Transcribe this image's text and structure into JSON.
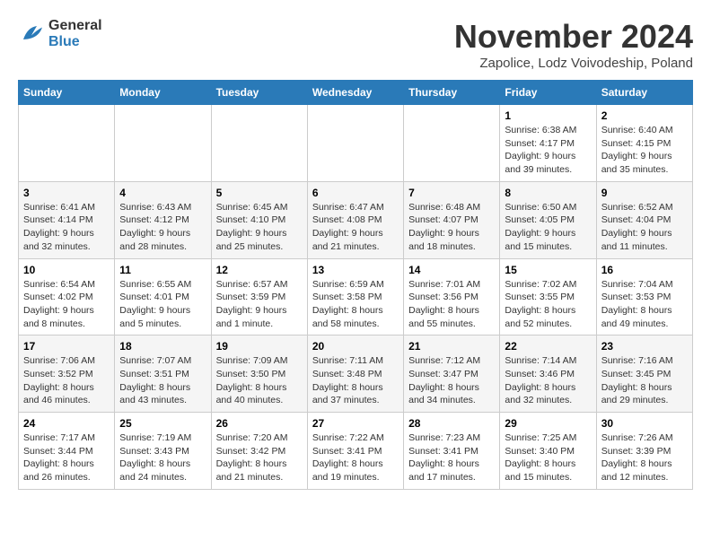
{
  "header": {
    "logo_line1": "General",
    "logo_line2": "Blue",
    "month": "November 2024",
    "location": "Zapolice, Lodz Voivodeship, Poland"
  },
  "days_of_week": [
    "Sunday",
    "Monday",
    "Tuesday",
    "Wednesday",
    "Thursday",
    "Friday",
    "Saturday"
  ],
  "weeks": [
    [
      {
        "day": "",
        "info": ""
      },
      {
        "day": "",
        "info": ""
      },
      {
        "day": "",
        "info": ""
      },
      {
        "day": "",
        "info": ""
      },
      {
        "day": "",
        "info": ""
      },
      {
        "day": "1",
        "info": "Sunrise: 6:38 AM\nSunset: 4:17 PM\nDaylight: 9 hours\nand 39 minutes."
      },
      {
        "day": "2",
        "info": "Sunrise: 6:40 AM\nSunset: 4:15 PM\nDaylight: 9 hours\nand 35 minutes."
      }
    ],
    [
      {
        "day": "3",
        "info": "Sunrise: 6:41 AM\nSunset: 4:14 PM\nDaylight: 9 hours\nand 32 minutes."
      },
      {
        "day": "4",
        "info": "Sunrise: 6:43 AM\nSunset: 4:12 PM\nDaylight: 9 hours\nand 28 minutes."
      },
      {
        "day": "5",
        "info": "Sunrise: 6:45 AM\nSunset: 4:10 PM\nDaylight: 9 hours\nand 25 minutes."
      },
      {
        "day": "6",
        "info": "Sunrise: 6:47 AM\nSunset: 4:08 PM\nDaylight: 9 hours\nand 21 minutes."
      },
      {
        "day": "7",
        "info": "Sunrise: 6:48 AM\nSunset: 4:07 PM\nDaylight: 9 hours\nand 18 minutes."
      },
      {
        "day": "8",
        "info": "Sunrise: 6:50 AM\nSunset: 4:05 PM\nDaylight: 9 hours\nand 15 minutes."
      },
      {
        "day": "9",
        "info": "Sunrise: 6:52 AM\nSunset: 4:04 PM\nDaylight: 9 hours\nand 11 minutes."
      }
    ],
    [
      {
        "day": "10",
        "info": "Sunrise: 6:54 AM\nSunset: 4:02 PM\nDaylight: 9 hours\nand 8 minutes."
      },
      {
        "day": "11",
        "info": "Sunrise: 6:55 AM\nSunset: 4:01 PM\nDaylight: 9 hours\nand 5 minutes."
      },
      {
        "day": "12",
        "info": "Sunrise: 6:57 AM\nSunset: 3:59 PM\nDaylight: 9 hours\nand 1 minute."
      },
      {
        "day": "13",
        "info": "Sunrise: 6:59 AM\nSunset: 3:58 PM\nDaylight: 8 hours\nand 58 minutes."
      },
      {
        "day": "14",
        "info": "Sunrise: 7:01 AM\nSunset: 3:56 PM\nDaylight: 8 hours\nand 55 minutes."
      },
      {
        "day": "15",
        "info": "Sunrise: 7:02 AM\nSunset: 3:55 PM\nDaylight: 8 hours\nand 52 minutes."
      },
      {
        "day": "16",
        "info": "Sunrise: 7:04 AM\nSunset: 3:53 PM\nDaylight: 8 hours\nand 49 minutes."
      }
    ],
    [
      {
        "day": "17",
        "info": "Sunrise: 7:06 AM\nSunset: 3:52 PM\nDaylight: 8 hours\nand 46 minutes."
      },
      {
        "day": "18",
        "info": "Sunrise: 7:07 AM\nSunset: 3:51 PM\nDaylight: 8 hours\nand 43 minutes."
      },
      {
        "day": "19",
        "info": "Sunrise: 7:09 AM\nSunset: 3:50 PM\nDaylight: 8 hours\nand 40 minutes."
      },
      {
        "day": "20",
        "info": "Sunrise: 7:11 AM\nSunset: 3:48 PM\nDaylight: 8 hours\nand 37 minutes."
      },
      {
        "day": "21",
        "info": "Sunrise: 7:12 AM\nSunset: 3:47 PM\nDaylight: 8 hours\nand 34 minutes."
      },
      {
        "day": "22",
        "info": "Sunrise: 7:14 AM\nSunset: 3:46 PM\nDaylight: 8 hours\nand 32 minutes."
      },
      {
        "day": "23",
        "info": "Sunrise: 7:16 AM\nSunset: 3:45 PM\nDaylight: 8 hours\nand 29 minutes."
      }
    ],
    [
      {
        "day": "24",
        "info": "Sunrise: 7:17 AM\nSunset: 3:44 PM\nDaylight: 8 hours\nand 26 minutes."
      },
      {
        "day": "25",
        "info": "Sunrise: 7:19 AM\nSunset: 3:43 PM\nDaylight: 8 hours\nand 24 minutes."
      },
      {
        "day": "26",
        "info": "Sunrise: 7:20 AM\nSunset: 3:42 PM\nDaylight: 8 hours\nand 21 minutes."
      },
      {
        "day": "27",
        "info": "Sunrise: 7:22 AM\nSunset: 3:41 PM\nDaylight: 8 hours\nand 19 minutes."
      },
      {
        "day": "28",
        "info": "Sunrise: 7:23 AM\nSunset: 3:41 PM\nDaylight: 8 hours\nand 17 minutes."
      },
      {
        "day": "29",
        "info": "Sunrise: 7:25 AM\nSunset: 3:40 PM\nDaylight: 8 hours\nand 15 minutes."
      },
      {
        "day": "30",
        "info": "Sunrise: 7:26 AM\nSunset: 3:39 PM\nDaylight: 8 hours\nand 12 minutes."
      }
    ]
  ]
}
